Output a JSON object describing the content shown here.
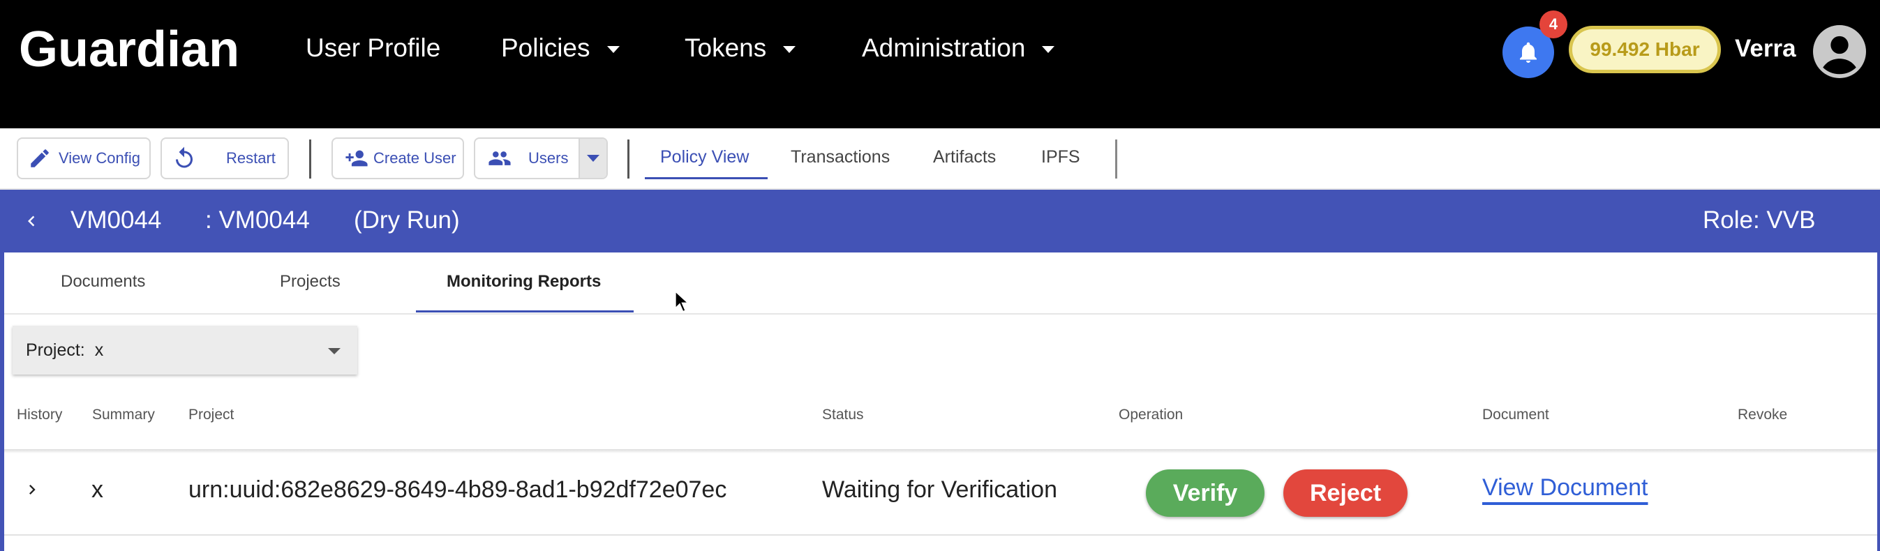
{
  "header": {
    "logo": "Guardian",
    "nav": [
      {
        "label": "User Profile",
        "has_dropdown": false
      },
      {
        "label": "Policies",
        "has_dropdown": true
      },
      {
        "label": "Tokens",
        "has_dropdown": true
      },
      {
        "label": "Administration",
        "has_dropdown": true
      }
    ],
    "notification_count": "4",
    "balance": "99.492 Hbar",
    "username": "Verra",
    "icons": {
      "notifications": "bell-icon",
      "account": "account-circle-icon"
    }
  },
  "toolbar": {
    "view_config": "View Config",
    "restart": "Restart",
    "create_user": "Create User",
    "users": "Users",
    "tabs": [
      "Policy View",
      "Transactions",
      "Artifacts",
      "IPFS"
    ],
    "active_tab": "Policy View"
  },
  "policy": {
    "id": "VM0044",
    "name": ": VM0044",
    "mode": "(Dry Run)",
    "role": "Role: VVB"
  },
  "subtabs": {
    "items": [
      "Documents",
      "Projects",
      "Monitoring Reports"
    ],
    "active": "Monitoring Reports"
  },
  "filter": {
    "label": "Project:",
    "value": "x"
  },
  "table": {
    "columns": [
      "History",
      "Summary",
      "Project",
      "Status",
      "Operation",
      "Document",
      "Revoke"
    ],
    "rows": [
      {
        "summary": "x",
        "project": "urn:uuid:682e8629-8649-4b89-8ad1-b92df72e07ec",
        "status": "Waiting for Verification",
        "verify_label": "Verify",
        "reject_label": "Reject",
        "document_link": "View Document"
      }
    ]
  },
  "colors": {
    "header_bg": "#000000",
    "policy_bar": "#4353b6",
    "accent": "#3b4fb4",
    "verify": "#5aab5b",
    "reject": "#e2473d",
    "notification": "#3e78f0",
    "balance_bg": "#f9f4c4"
  }
}
